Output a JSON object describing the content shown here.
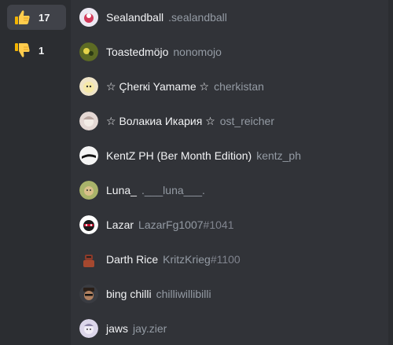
{
  "reactions": [
    {
      "icon": "thumbs-up-icon",
      "count": "17",
      "selected": true
    },
    {
      "icon": "thumbs-down-icon",
      "count": "1",
      "selected": false
    }
  ],
  "users": [
    {
      "display_name": "Sealandball",
      "username": ".sealandball",
      "discriminator": "",
      "avatar_color": "#e8e6ef"
    },
    {
      "display_name": "Toastedmöjo",
      "username": "nonomojo",
      "discriminator": "",
      "avatar_color": "#6f7b2a"
    },
    {
      "display_name": "☆ Çherкi Yamame ☆",
      "username": "cherkistan",
      "discriminator": "",
      "avatar_color": "#e9d9b2"
    },
    {
      "display_name": "☆ Волакиа Икария ☆",
      "username": "ost_reicher",
      "discriminator": "",
      "avatar_color": "#d9c7c2"
    },
    {
      "display_name": "KentZ PH (Ber Month Edition)",
      "username": "kentz_ph",
      "discriminator": "",
      "avatar_color": "#f2f2f2"
    },
    {
      "display_name": "Luna_",
      "username": ".___luna___.",
      "discriminator": "",
      "avatar_color": "#b9c27a"
    },
    {
      "display_name": "Lazar",
      "username": "LazarFg1007",
      "discriminator": "#1041",
      "avatar_color": "#1a1a1a"
    },
    {
      "display_name": "Darth Rice",
      "username": "KritzKrieg",
      "discriminator": "#1100",
      "avatar_color": "#7a3b2f"
    },
    {
      "display_name": "bing chilli",
      "username": "chilliwillibilli",
      "discriminator": "",
      "avatar_color": "#8a6a4a"
    },
    {
      "display_name": "jaws",
      "username": "jay.zier",
      "discriminator": "",
      "avatar_color": "#d6d0e6"
    }
  ]
}
